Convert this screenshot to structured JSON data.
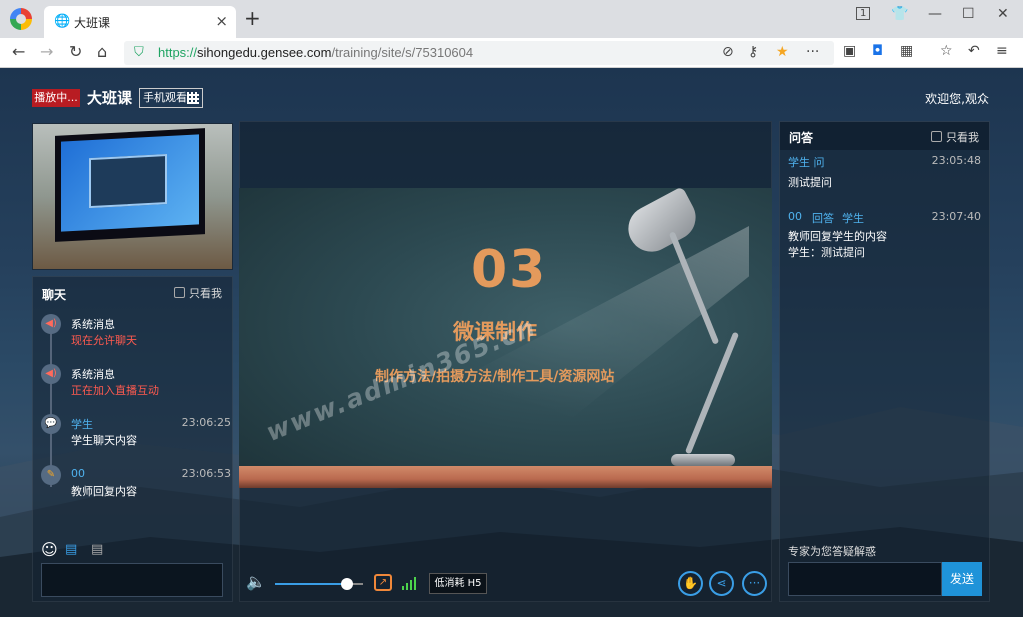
{
  "browser": {
    "tab_title": "大班课",
    "tab_count": "1",
    "url_protocol": "https://",
    "url_host": "sihongedu.gensee.com",
    "url_path": "/training/site/s/75310604"
  },
  "header": {
    "live_badge": "播放中...",
    "course_title": "大班课",
    "mobile_watch": "手机观看",
    "welcome": "欢迎您,观众"
  },
  "chat": {
    "title": "聊天",
    "only_me": "只看我",
    "messages": [
      {
        "name": "系统消息",
        "text": "现在允许聊天",
        "time": ""
      },
      {
        "name": "系统消息",
        "text": "正在加入直播互动",
        "time": ""
      },
      {
        "name": "学生",
        "text": "学生聊天内容",
        "time": "23:06:25"
      },
      {
        "name": "00",
        "text": "教师回复内容",
        "time": "23:06:53"
      }
    ]
  },
  "slide": {
    "number": "03",
    "title": "微课制作",
    "subtitle": "制作方法/拍摄方法/制作工具/资源网站",
    "watermark": "www.admin365.cn"
  },
  "controls": {
    "mode": "低消耗 H5",
    "volume_fraction": 0.82
  },
  "qa": {
    "title": "问答",
    "only_me": "只看我",
    "items": [
      {
        "asker": "学生 问",
        "time": "23:05:48",
        "text": "测试提问"
      },
      {
        "asker": "00",
        "tag1": "回答",
        "tag2": "学生",
        "time": "23:07:40",
        "reply": "教师回复学生的内容",
        "quote": "学生：测试提问"
      }
    ],
    "footer_label": "专家为您答疑解惑",
    "send": "发送"
  },
  "colors": {
    "accent": "#1f93d9",
    "live": "#b81c22",
    "slide_text": "#e49a5c"
  }
}
